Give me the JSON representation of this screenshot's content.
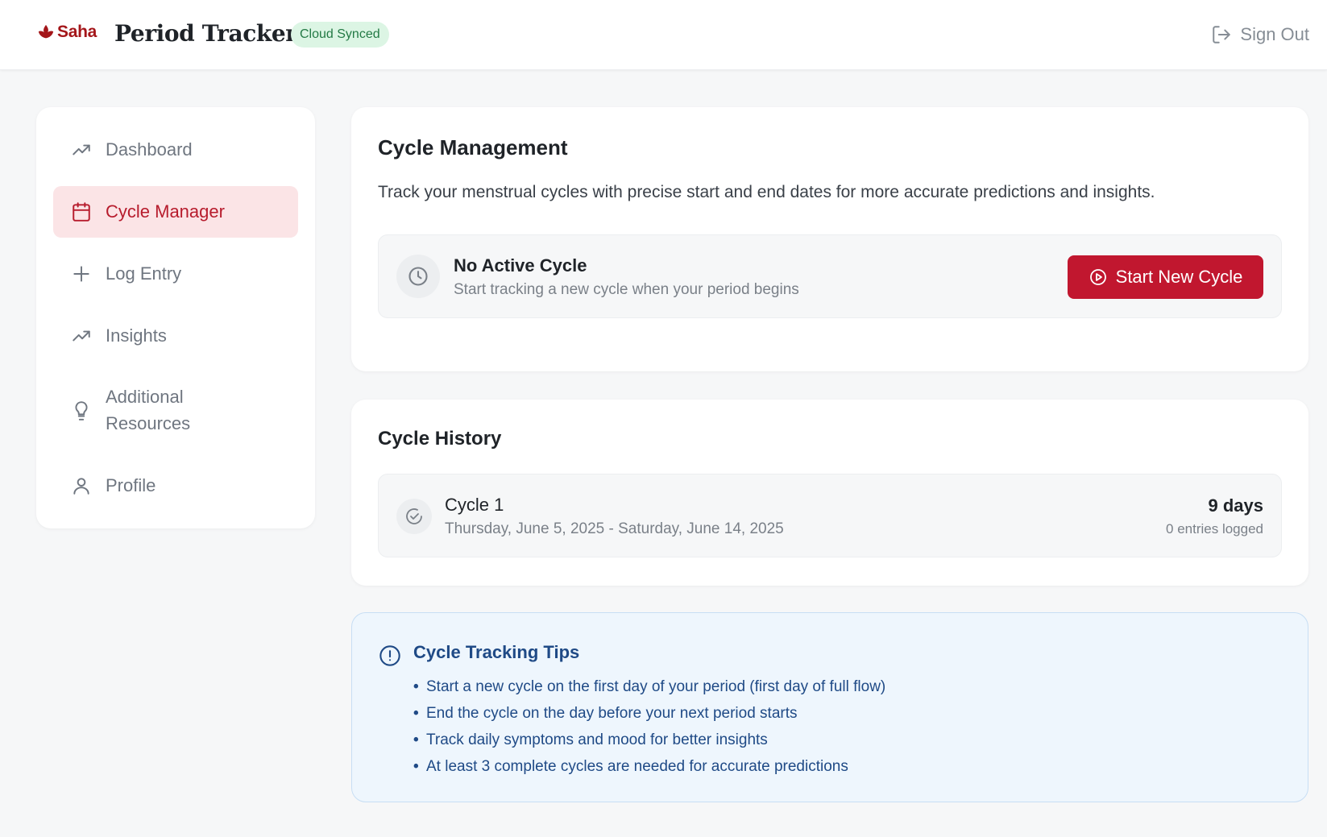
{
  "header": {
    "logo_text": "Saha",
    "app_title": "Period Tracker",
    "sync_badge": "Cloud Synced",
    "sign_out": "Sign Out"
  },
  "sidebar": {
    "items": [
      {
        "label": "Dashboard",
        "icon": "trending-up-icon",
        "active": false
      },
      {
        "label": "Cycle Manager",
        "icon": "calendar-icon",
        "active": true
      },
      {
        "label": "Log Entry",
        "icon": "plus-icon",
        "active": false
      },
      {
        "label": "Insights",
        "icon": "trending-up-icon",
        "active": false
      },
      {
        "label": "Additional",
        "label_line2": "Resources",
        "icon": "lightbulb-icon",
        "active": false
      },
      {
        "label": "Profile",
        "icon": "user-icon",
        "active": false
      }
    ]
  },
  "cycle_management": {
    "title": "Cycle Management",
    "description": "Track your menstrual cycles with precise start and end dates for more accurate predictions and insights.",
    "status_title": "No Active Cycle",
    "status_subtitle": "Start tracking a new cycle when your period begins",
    "start_button": "Start New Cycle"
  },
  "cycle_history": {
    "title": "Cycle History",
    "cycles": [
      {
        "name": "Cycle 1",
        "dates": "Thursday, June 5, 2025 - Saturday, June 14, 2025",
        "duration": "9 days",
        "entries": "0 entries logged"
      }
    ]
  },
  "tips": {
    "title": "Cycle Tracking Tips",
    "items": [
      "Start a new cycle on the first day of your period (first day of full flow)",
      "End the cycle on the day before your next period starts",
      "Track daily symptoms and mood for better insights",
      "At least 3 complete cycles are needed for accurate predictions"
    ]
  },
  "colors": {
    "brand": "#a4161a",
    "primary_button": "#c1172f",
    "active_nav_bg": "#fbe4e6",
    "sync_badge_bg": "#dcf5e4",
    "tips_bg": "#eef6fd",
    "tips_text": "#1f4a86"
  }
}
